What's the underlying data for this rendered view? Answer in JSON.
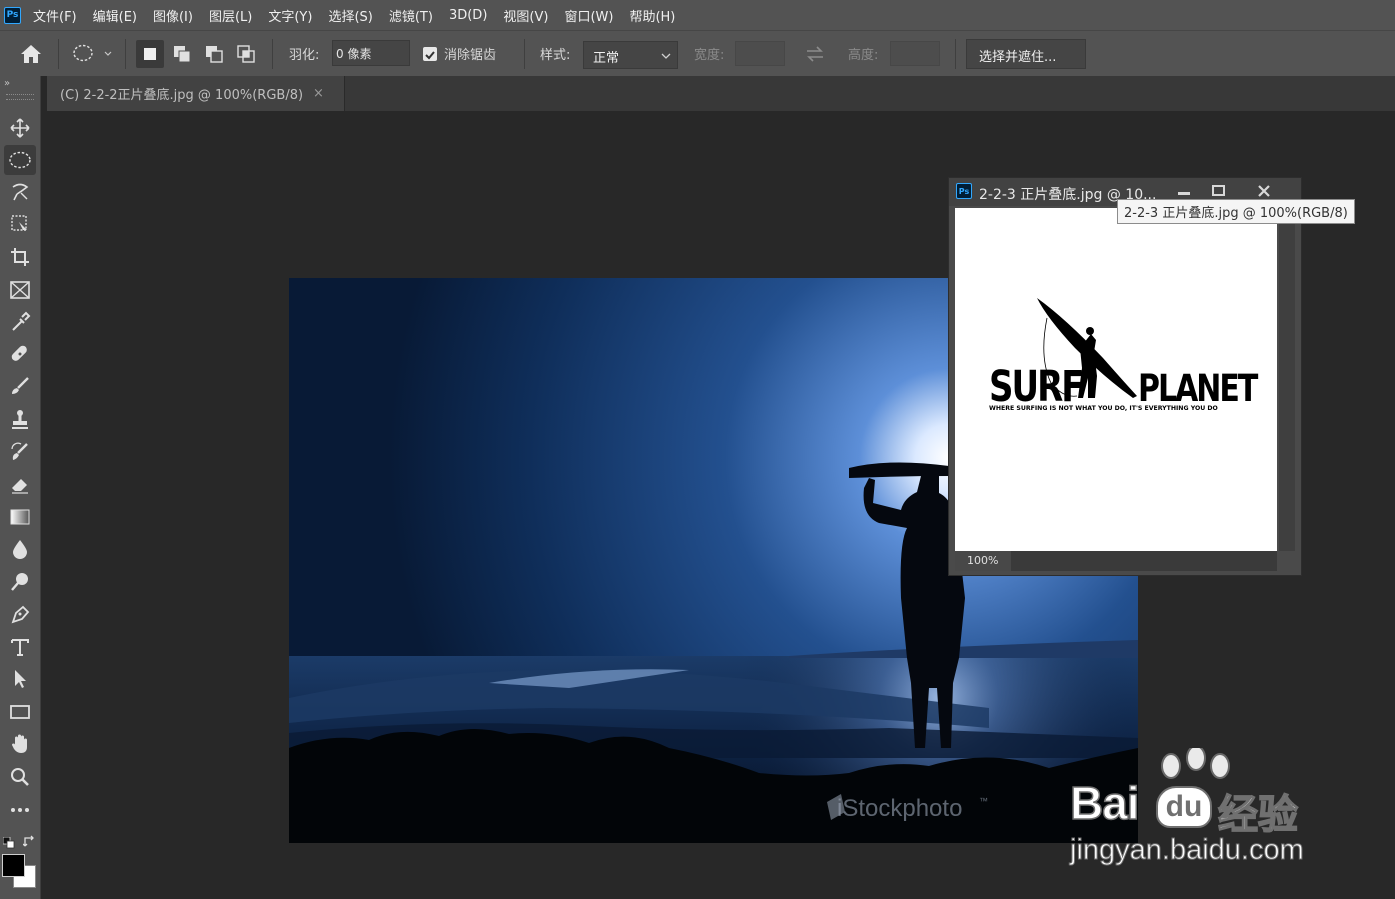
{
  "menu": [
    "文件(F)",
    "编辑(E)",
    "图像(I)",
    "图层(L)",
    "文字(Y)",
    "选择(S)",
    "滤镜(T)",
    "3D(D)",
    "视图(V)",
    "窗口(W)",
    "帮助(H)"
  ],
  "app_logo": "Ps",
  "options": {
    "feather_label": "羽化:",
    "feather_value": "0 像素",
    "antialias_label": "消除锯齿",
    "antialias_checked": true,
    "style_label": "样式:",
    "style_value": "正常",
    "width_label": "宽度:",
    "height_label": "高度:",
    "select_mask_button": "选择并遮住..."
  },
  "document_tab": {
    "title": "(C) 2-2-2正片叠底.jpg @ 100%(RGB/8)",
    "close": "×"
  },
  "photo": {
    "watermark": "iStockphoto",
    "watermark_tm": "™"
  },
  "floating_window": {
    "logo": "Ps",
    "title": "2-2-3 正片叠底.jpg @ 10...",
    "tooltip": "2-2-3 正片叠底.jpg @ 100%(RGB/8)",
    "zoom": "100%",
    "logo_text_left": "SURF",
    "logo_text_right": "PLANET",
    "tagline": "WHERE SURFING IS NOT WHAT YOU DO, IT'S EVERYTHING YOU DO"
  },
  "watermark_site": {
    "brand_left": "Bai",
    "brand_right": "经验",
    "url": "jingyan.baidu.com"
  },
  "colors": {
    "foreground": "#000000",
    "background": "#ffffff",
    "accent": "#31a8ff"
  },
  "tools": [
    "move-icon",
    "ellipse-marquee-icon",
    "lasso-icon",
    "object-select-icon",
    "crop-icon",
    "frame-icon",
    "eyedropper-icon",
    "healing-brush-icon",
    "brush-icon",
    "stamp-icon",
    "history-brush-icon",
    "eraser-icon",
    "gradient-icon",
    "blur-icon",
    "dodge-icon",
    "pen-icon",
    "type-icon",
    "path-select-icon",
    "rectangle-icon",
    "hand-icon",
    "zoom-icon",
    "more-icon"
  ]
}
